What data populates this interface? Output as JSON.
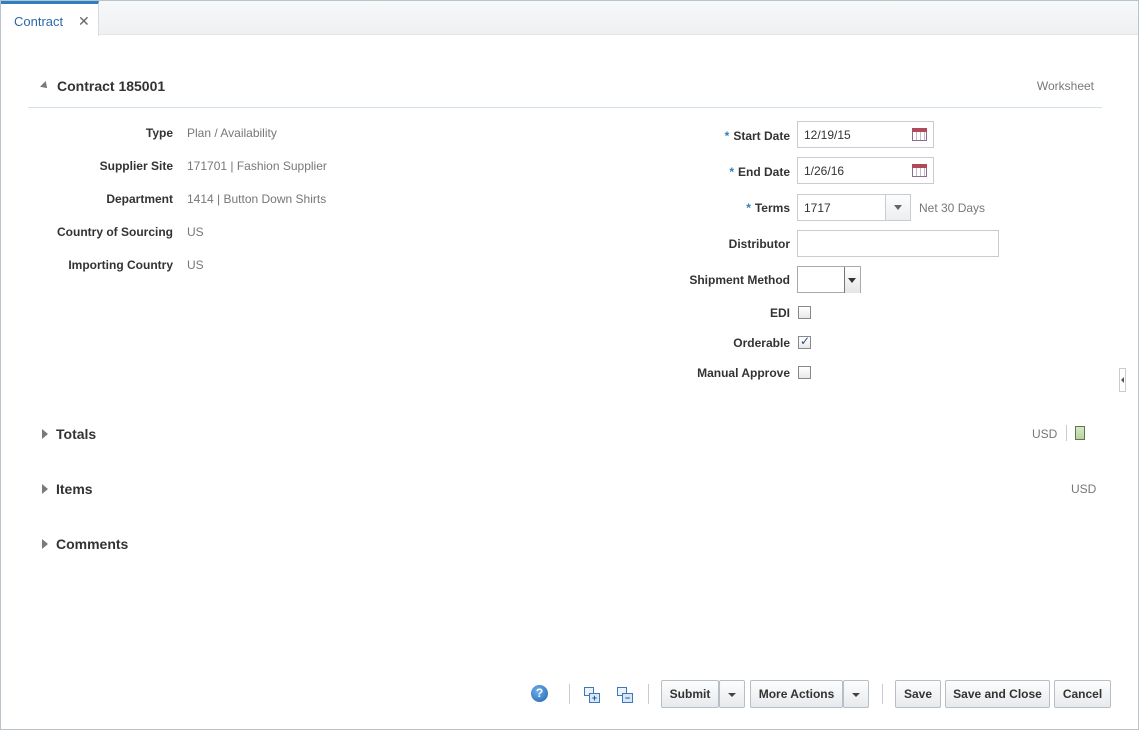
{
  "tab": {
    "label": "Contract",
    "close": "✕"
  },
  "header": {
    "title": "Contract 185001",
    "status": "Worksheet"
  },
  "left_fields": [
    {
      "label": "Type",
      "value": "Plan / Availability"
    },
    {
      "label": "Supplier Site",
      "value": "171701 | Fashion Supplier"
    },
    {
      "label": "Department",
      "value": "1414 | Button Down Shirts"
    },
    {
      "label": "Country of Sourcing",
      "value": "US"
    },
    {
      "label": "Importing Country",
      "value": "US"
    }
  ],
  "right_fields": {
    "required_marker": "*",
    "start_date": {
      "label": "Start Date",
      "value": "12/19/15"
    },
    "end_date": {
      "label": "End Date",
      "value": "1/26/16"
    },
    "terms": {
      "label": "Terms",
      "value": "1717",
      "description": "Net 30 Days"
    },
    "distributor": {
      "label": "Distributor",
      "value": ""
    },
    "shipment_method": {
      "label": "Shipment Method",
      "value": ""
    },
    "edi": {
      "label": "EDI",
      "checked": false
    },
    "orderable": {
      "label": "Orderable",
      "checked": true
    },
    "manual_approve": {
      "label": "Manual Approve",
      "checked": false
    }
  },
  "sections": {
    "totals": {
      "title": "Totals",
      "currency": "USD"
    },
    "items": {
      "title": "Items",
      "currency": "USD"
    },
    "comments": {
      "title": "Comments"
    }
  },
  "footer": {
    "help": "?",
    "submit": "Submit",
    "more_actions": "More Actions",
    "save": "Save",
    "save_and_close": "Save and Close",
    "cancel": "Cancel"
  },
  "colors": {
    "accent": "#2d7fc1",
    "required": "#2d7fc1"
  }
}
